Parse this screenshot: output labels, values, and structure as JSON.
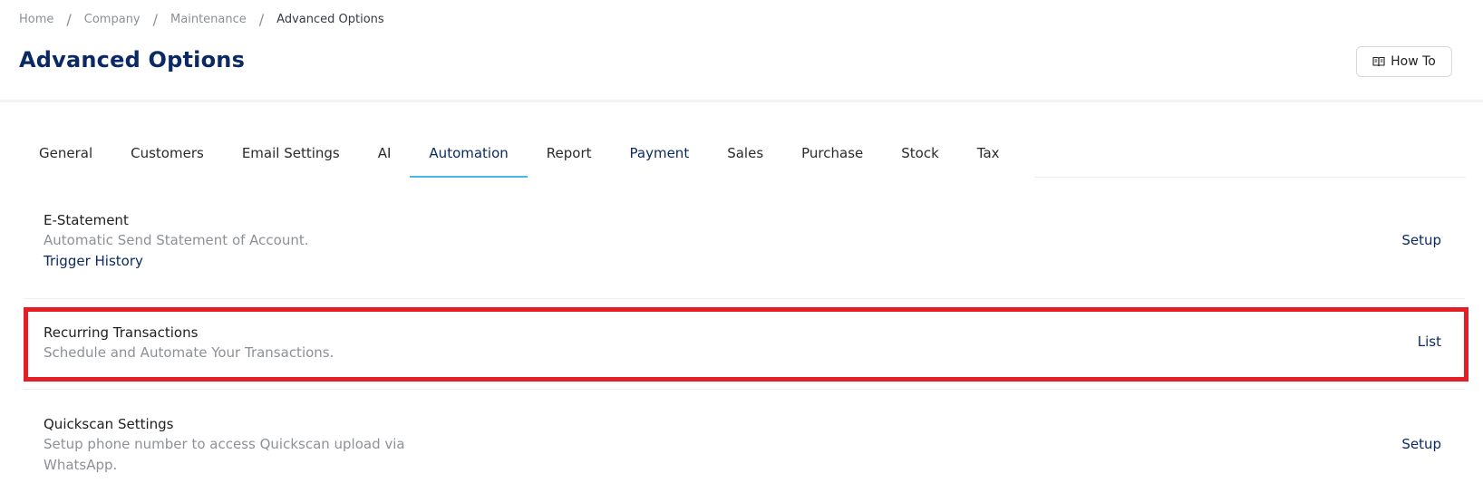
{
  "breadcrumb": {
    "items": [
      "Home",
      "Company",
      "Maintenance"
    ],
    "current": "Advanced Options",
    "separator": "/"
  },
  "page": {
    "title": "Advanced Options"
  },
  "header": {
    "how_to_label": "How To",
    "how_to_icon": "book-open-icon"
  },
  "tabs": [
    {
      "label": "General"
    },
    {
      "label": "Customers"
    },
    {
      "label": "Email Settings"
    },
    {
      "label": "AI"
    },
    {
      "label": "Automation",
      "active": true
    },
    {
      "label": "Report"
    },
    {
      "label": "Payment"
    },
    {
      "label": "Sales"
    },
    {
      "label": "Purchase"
    },
    {
      "label": "Stock"
    },
    {
      "label": "Tax"
    }
  ],
  "settings": {
    "estatement": {
      "title": "E-Statement",
      "description": "Automatic Send Statement of Account.",
      "link": "Trigger History",
      "action": "Setup"
    },
    "recurring": {
      "title": "Recurring Transactions",
      "description": "Schedule and Automate Your Transactions.",
      "action": "List"
    },
    "quickscan": {
      "title": "Quickscan Settings",
      "description_line1": "Setup phone number to access Quickscan upload via",
      "description_line2": "WhatsApp.",
      "action": "Setup"
    }
  },
  "colors": {
    "brand_navy": "#0b2a63",
    "tab_active_underline": "#4bb7e8",
    "highlight_red": "#e31e24",
    "muted_text": "#8d9096"
  }
}
